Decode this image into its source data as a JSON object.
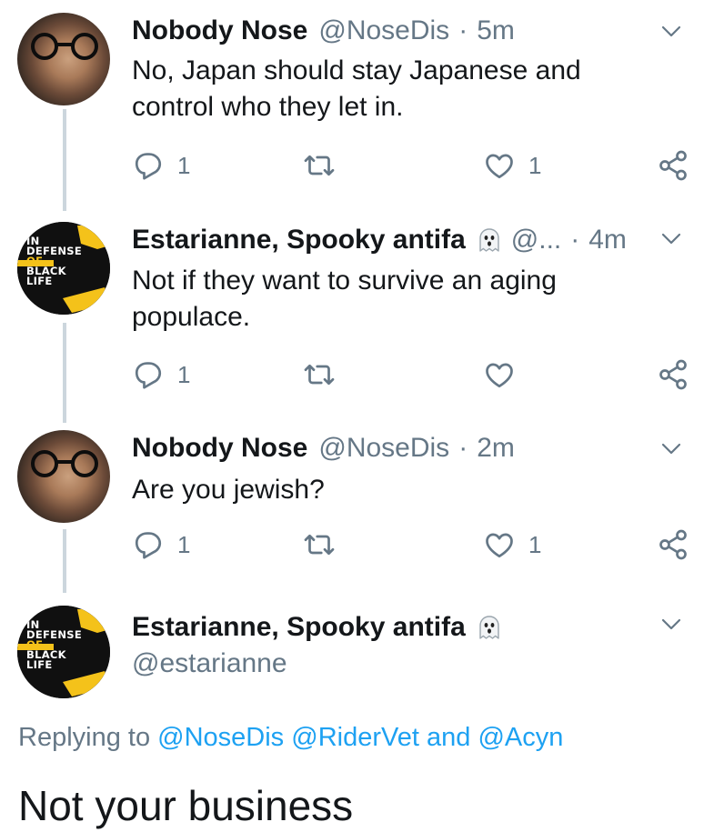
{
  "tweets": [
    {
      "name": "Nobody Nose",
      "handle": "@NoseDis",
      "separator": "·",
      "time": "5m",
      "text_lines": [
        "No, Japan should stay Japanese and",
        "control who they let in."
      ],
      "reply_count": "1",
      "like_count": "1",
      "avatar_icon": "glasses-face-avatar"
    },
    {
      "name": "Estarianne, Spooky antifa",
      "handle": "@...",
      "separator": "·",
      "time": "4m",
      "text_lines": [
        "Not if they want to survive an aging",
        "populace."
      ],
      "reply_count": "1",
      "like_count": "",
      "avatar_icon": "in-defense-of-black-life-avatar"
    },
    {
      "name": "Nobody Nose",
      "handle": "@NoseDis",
      "separator": "·",
      "time": "2m",
      "text_lines": [
        "Are you jewish?"
      ],
      "reply_count": "1",
      "like_count": "1",
      "avatar_icon": "glasses-face-avatar"
    }
  ],
  "focused": {
    "name": "Estarianne, Spooky antifa",
    "handle": "@estarianne",
    "replying_prefix": "Replying to",
    "mentions": [
      "@NoseDis",
      "@RiderVet",
      "@Acyn"
    ],
    "mention_joiner": "and",
    "text": "Not your business"
  },
  "avatar_lettering": {
    "line1": "IN",
    "line2": "DEFENSE",
    "line3": "OF",
    "line4": "BLACK",
    "line5": "LIFE"
  },
  "colors": {
    "text": "#14171a",
    "muted": "#657786",
    "link": "#1da1f2",
    "thread_line": "#ccd6dd",
    "avatar_yellow": "#f4c21a"
  }
}
